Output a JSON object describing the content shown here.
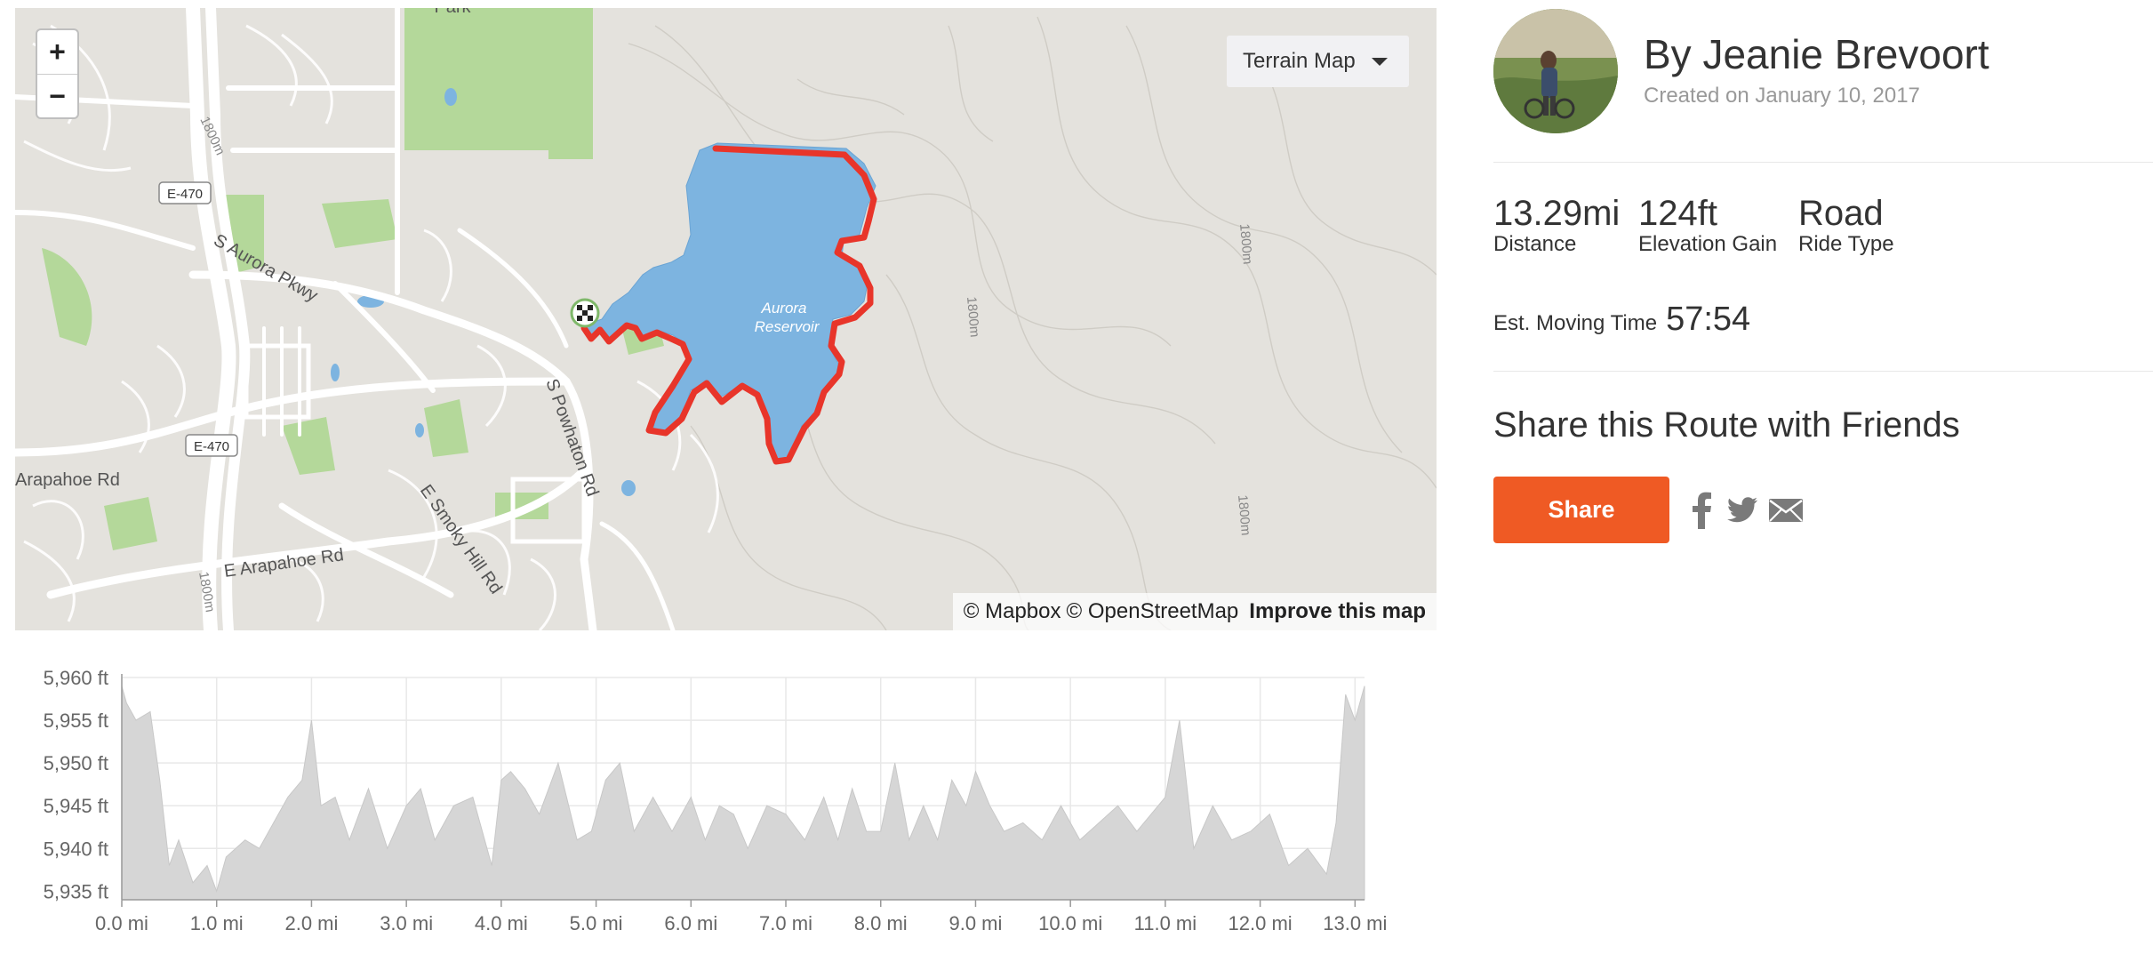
{
  "map": {
    "zoom_in_label": "+",
    "zoom_out_label": "−",
    "layer_select_label": "Terrain Map",
    "attribution": {
      "mapbox": "© Mapbox",
      "osm": "© OpenStreetMap",
      "improve": "Improve this map"
    },
    "labels": {
      "park": "Park",
      "e470_top": "E-470",
      "e470_bottom": "E-470",
      "aurora_pkwy": "S Aurora Pkwy",
      "arapahoe_rd": "Arapahoe Rd",
      "e_arapahoe_rd": "E Arapahoe Rd",
      "smoky_hill": "E Smoky Hill Rd",
      "powhaton": "S Powhaton Rd",
      "reservoir_1": "Aurora",
      "reservoir_2": "Reservoir",
      "contour_1": "1800m",
      "contour_2": "1800m",
      "contour_3": "1800m",
      "contour_4": "1800m",
      "contour_5": "1800m"
    },
    "colors": {
      "route": "#e8352a",
      "water": "#7db4e0",
      "park": "#b4d89a",
      "land": "#e4e2dd"
    }
  },
  "chart_data": {
    "type": "area",
    "title": "",
    "xlabel": "",
    "ylabel": "",
    "x_unit": "mi",
    "y_unit": "ft",
    "xlim": [
      0,
      13.1
    ],
    "ylim": [
      5934,
      5960
    ],
    "x_ticks": [
      "0.0 mi",
      "1.0 mi",
      "2.0 mi",
      "3.0 mi",
      "4.0 mi",
      "5.0 mi",
      "6.0 mi",
      "7.0 mi",
      "8.0 mi",
      "9.0 mi",
      "10.0 mi",
      "11.0 mi",
      "12.0 mi",
      "13.0 mi"
    ],
    "y_ticks": [
      "5,960 ft",
      "5,955 ft",
      "5,950 ft",
      "5,945 ft",
      "5,940 ft",
      "5,935 ft"
    ],
    "grid": true,
    "color": "#d6d6d6",
    "series": [
      {
        "x": [
          0,
          0.05,
          0.15,
          0.3,
          0.4,
          0.5,
          0.6,
          0.75,
          0.9,
          1.0,
          1.1,
          1.3,
          1.45,
          1.6,
          1.75,
          1.9,
          2.0,
          2.1,
          2.25,
          2.4,
          2.6,
          2.8,
          3.0,
          3.15,
          3.3,
          3.5,
          3.7,
          3.9,
          4.0,
          4.1,
          4.25,
          4.4,
          4.6,
          4.8,
          4.95,
          5.1,
          5.25,
          5.4,
          5.6,
          5.8,
          6.0,
          6.15,
          6.3,
          6.45,
          6.6,
          6.8,
          7.0,
          7.2,
          7.4,
          7.55,
          7.7,
          7.85,
          8.0,
          8.15,
          8.3,
          8.45,
          8.6,
          8.75,
          8.9,
          9.0,
          9.15,
          9.3,
          9.5,
          9.7,
          9.9,
          10.1,
          10.3,
          10.5,
          10.7,
          10.85,
          11.0,
          11.15,
          11.3,
          11.5,
          11.7,
          11.9,
          12.1,
          12.3,
          12.5,
          12.7,
          12.8,
          12.9,
          13.0,
          13.1
        ],
        "y": [
          5959,
          5957,
          5955,
          5956,
          5948,
          5938,
          5941,
          5936,
          5938,
          5935,
          5939,
          5941,
          5940,
          5943,
          5946,
          5948,
          5955,
          5945,
          5946,
          5941,
          5947,
          5940,
          5945,
          5947,
          5941,
          5945,
          5946,
          5938,
          5948,
          5949,
          5947,
          5944,
          5950,
          5941,
          5942,
          5948,
          5950,
          5942,
          5946,
          5942,
          5946,
          5941,
          5945,
          5944,
          5940,
          5945,
          5944,
          5941,
          5946,
          5941,
          5947,
          5942,
          5942,
          5950,
          5941,
          5945,
          5941,
          5948,
          5945,
          5949,
          5945,
          5942,
          5943,
          5941,
          5945,
          5941,
          5943,
          5945,
          5942,
          5944,
          5946,
          5955,
          5940,
          5945,
          5941,
          5942,
          5944,
          5938,
          5940,
          5937,
          5943,
          5958,
          5955,
          5959
        ]
      }
    ]
  },
  "profile": {
    "author": "By Jeanie Brevoort",
    "created": "Created on January 10, 2017",
    "distance_value": "13.29mi",
    "distance_label": "Distance",
    "elevation_value": "124ft",
    "elevation_label": "Elevation Gain",
    "type_value": "Road",
    "type_label": "Ride Type",
    "moving_label": "Est. Moving Time",
    "moving_value": "57:54",
    "share_heading": "Share this Route with Friends",
    "share_button": "Share",
    "icon_color": "#7a7a7a"
  }
}
